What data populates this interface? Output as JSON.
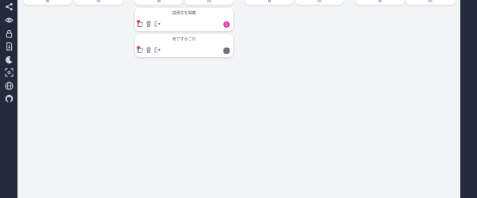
{
  "sidebar": {
    "items": [
      {
        "icon": "share-icon"
      },
      {
        "icon": "eye-icon"
      },
      {
        "icon": "lock-icon"
      },
      {
        "icon": "file-download-icon"
      },
      {
        "icon": "moon-icon"
      },
      {
        "icon": "scan-icon"
      },
      {
        "icon": "globe-icon"
      },
      {
        "icon": "github-icon"
      }
    ]
  },
  "cards": [
    {
      "text": "説明文を掲載",
      "avatar": "2",
      "avatar_color": "#d946b8",
      "has_dot": true
    },
    {
      "text": "何ですかこれ",
      "avatar": "",
      "avatar_color": "#7c6f7c",
      "has_dot": true
    }
  ],
  "colors": {
    "sidebar": "#222b3b",
    "background": "#f3f4f6",
    "card": "#ffffff",
    "notification_dot": "#ef4444"
  }
}
